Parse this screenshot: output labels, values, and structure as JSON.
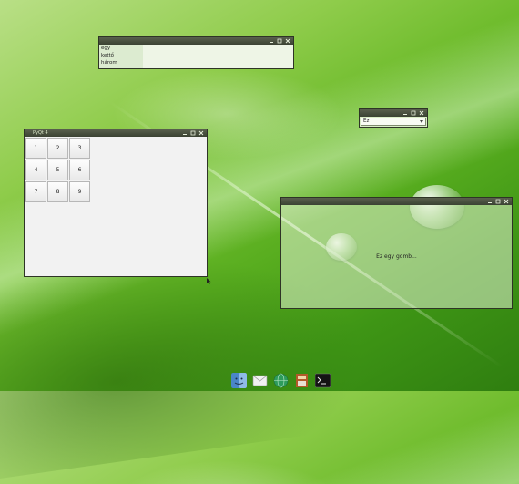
{
  "windows": {
    "list_window": {
      "items": [
        "egy",
        "kettő",
        "három"
      ]
    },
    "combo_window": {
      "selected": "Ez"
    },
    "grid_window": {
      "title": "PyQt 4",
      "buttons": [
        "1",
        "2",
        "3",
        "4",
        "5",
        "6",
        "7",
        "8",
        "9"
      ]
    },
    "button_window": {
      "button_label": "Ez egy gomb..."
    }
  },
  "dock": {
    "icons": [
      "finder-icon",
      "mail-icon",
      "browser-globe-icon",
      "book-icon",
      "terminal-icon"
    ]
  },
  "colors": {
    "titlebar": "#3b4233",
    "leaf_green": "#6fbc2d",
    "window_body": "#f2f2f2"
  }
}
